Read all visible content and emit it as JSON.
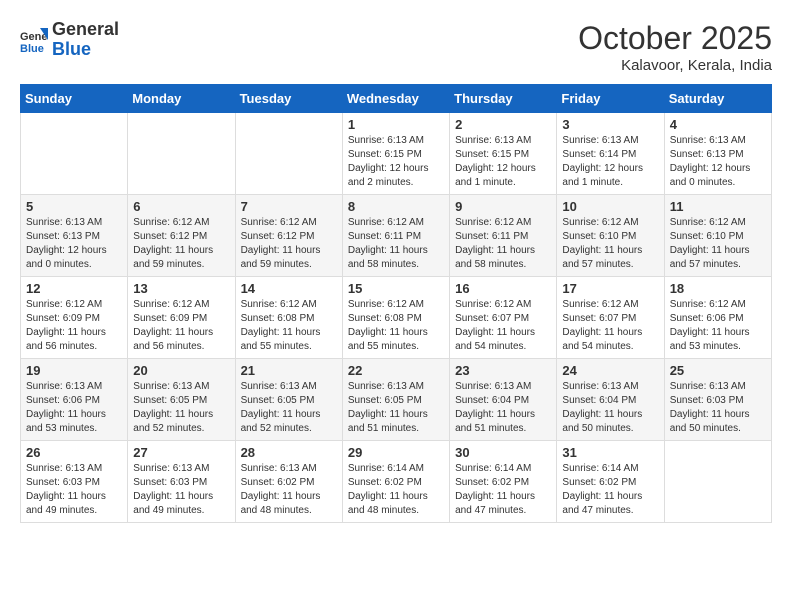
{
  "header": {
    "logo_general": "General",
    "logo_blue": "Blue",
    "month": "October 2025",
    "location": "Kalavoor, Kerala, India"
  },
  "weekdays": [
    "Sunday",
    "Monday",
    "Tuesday",
    "Wednesday",
    "Thursday",
    "Friday",
    "Saturday"
  ],
  "weeks": [
    [
      {
        "day": "",
        "info": ""
      },
      {
        "day": "",
        "info": ""
      },
      {
        "day": "",
        "info": ""
      },
      {
        "day": "1",
        "info": "Sunrise: 6:13 AM\nSunset: 6:15 PM\nDaylight: 12 hours\nand 2 minutes."
      },
      {
        "day": "2",
        "info": "Sunrise: 6:13 AM\nSunset: 6:15 PM\nDaylight: 12 hours\nand 1 minute."
      },
      {
        "day": "3",
        "info": "Sunrise: 6:13 AM\nSunset: 6:14 PM\nDaylight: 12 hours\nand 1 minute."
      },
      {
        "day": "4",
        "info": "Sunrise: 6:13 AM\nSunset: 6:13 PM\nDaylight: 12 hours\nand 0 minutes."
      }
    ],
    [
      {
        "day": "5",
        "info": "Sunrise: 6:13 AM\nSunset: 6:13 PM\nDaylight: 12 hours\nand 0 minutes."
      },
      {
        "day": "6",
        "info": "Sunrise: 6:12 AM\nSunset: 6:12 PM\nDaylight: 11 hours\nand 59 minutes."
      },
      {
        "day": "7",
        "info": "Sunrise: 6:12 AM\nSunset: 6:12 PM\nDaylight: 11 hours\nand 59 minutes."
      },
      {
        "day": "8",
        "info": "Sunrise: 6:12 AM\nSunset: 6:11 PM\nDaylight: 11 hours\nand 58 minutes."
      },
      {
        "day": "9",
        "info": "Sunrise: 6:12 AM\nSunset: 6:11 PM\nDaylight: 11 hours\nand 58 minutes."
      },
      {
        "day": "10",
        "info": "Sunrise: 6:12 AM\nSunset: 6:10 PM\nDaylight: 11 hours\nand 57 minutes."
      },
      {
        "day": "11",
        "info": "Sunrise: 6:12 AM\nSunset: 6:10 PM\nDaylight: 11 hours\nand 57 minutes."
      }
    ],
    [
      {
        "day": "12",
        "info": "Sunrise: 6:12 AM\nSunset: 6:09 PM\nDaylight: 11 hours\nand 56 minutes."
      },
      {
        "day": "13",
        "info": "Sunrise: 6:12 AM\nSunset: 6:09 PM\nDaylight: 11 hours\nand 56 minutes."
      },
      {
        "day": "14",
        "info": "Sunrise: 6:12 AM\nSunset: 6:08 PM\nDaylight: 11 hours\nand 55 minutes."
      },
      {
        "day": "15",
        "info": "Sunrise: 6:12 AM\nSunset: 6:08 PM\nDaylight: 11 hours\nand 55 minutes."
      },
      {
        "day": "16",
        "info": "Sunrise: 6:12 AM\nSunset: 6:07 PM\nDaylight: 11 hours\nand 54 minutes."
      },
      {
        "day": "17",
        "info": "Sunrise: 6:12 AM\nSunset: 6:07 PM\nDaylight: 11 hours\nand 54 minutes."
      },
      {
        "day": "18",
        "info": "Sunrise: 6:12 AM\nSunset: 6:06 PM\nDaylight: 11 hours\nand 53 minutes."
      }
    ],
    [
      {
        "day": "19",
        "info": "Sunrise: 6:13 AM\nSunset: 6:06 PM\nDaylight: 11 hours\nand 53 minutes."
      },
      {
        "day": "20",
        "info": "Sunrise: 6:13 AM\nSunset: 6:05 PM\nDaylight: 11 hours\nand 52 minutes."
      },
      {
        "day": "21",
        "info": "Sunrise: 6:13 AM\nSunset: 6:05 PM\nDaylight: 11 hours\nand 52 minutes."
      },
      {
        "day": "22",
        "info": "Sunrise: 6:13 AM\nSunset: 6:05 PM\nDaylight: 11 hours\nand 51 minutes."
      },
      {
        "day": "23",
        "info": "Sunrise: 6:13 AM\nSunset: 6:04 PM\nDaylight: 11 hours\nand 51 minutes."
      },
      {
        "day": "24",
        "info": "Sunrise: 6:13 AM\nSunset: 6:04 PM\nDaylight: 11 hours\nand 50 minutes."
      },
      {
        "day": "25",
        "info": "Sunrise: 6:13 AM\nSunset: 6:03 PM\nDaylight: 11 hours\nand 50 minutes."
      }
    ],
    [
      {
        "day": "26",
        "info": "Sunrise: 6:13 AM\nSunset: 6:03 PM\nDaylight: 11 hours\nand 49 minutes."
      },
      {
        "day": "27",
        "info": "Sunrise: 6:13 AM\nSunset: 6:03 PM\nDaylight: 11 hours\nand 49 minutes."
      },
      {
        "day": "28",
        "info": "Sunrise: 6:13 AM\nSunset: 6:02 PM\nDaylight: 11 hours\nand 48 minutes."
      },
      {
        "day": "29",
        "info": "Sunrise: 6:14 AM\nSunset: 6:02 PM\nDaylight: 11 hours\nand 48 minutes."
      },
      {
        "day": "30",
        "info": "Sunrise: 6:14 AM\nSunset: 6:02 PM\nDaylight: 11 hours\nand 47 minutes."
      },
      {
        "day": "31",
        "info": "Sunrise: 6:14 AM\nSunset: 6:02 PM\nDaylight: 11 hours\nand 47 minutes."
      },
      {
        "day": "",
        "info": ""
      }
    ]
  ]
}
